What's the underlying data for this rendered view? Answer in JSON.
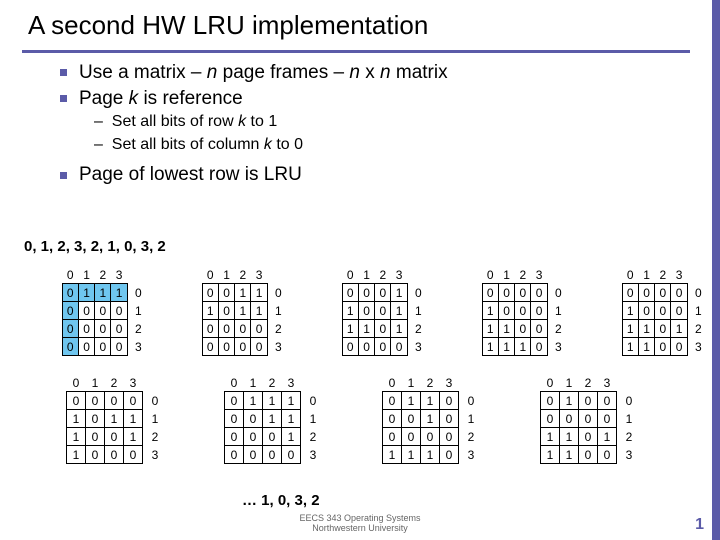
{
  "title": "A second HW LRU implementation",
  "b1a": "Use a matrix –",
  "b1n1": "n",
  "b1b": "page frames –",
  "b1n2": "n",
  "b1x": "x",
  "b1n3": "n",
  "b1c": "matrix",
  "b2a": "Page",
  "b2k": "k",
  "b2b": "is reference",
  "s1a": "Set all bits of row",
  "s1k": "k",
  "s1b": "to 1",
  "s2a": "Set all bits of column",
  "s2k": "k",
  "s2b": "to 0",
  "b3": "Page of lowest row is LRU",
  "seq": "0, 1, 2, 3, 2, 1, 0, 3, 2",
  "ans": "… 1, 0, 3, 2",
  "foot1": "EECS 343 Operating Systems",
  "foot2": "Northwestern University",
  "page": "1",
  "cols": [
    "0",
    "1",
    "2",
    "3"
  ],
  "rows": [
    "0",
    "1",
    "2",
    "3"
  ],
  "mats": [
    {
      "hl": [
        [
          0,
          0
        ],
        [
          0,
          1
        ],
        [
          0,
          2
        ],
        [
          0,
          3
        ],
        [
          1,
          0
        ],
        [
          2,
          0
        ],
        [
          3,
          0
        ]
      ],
      "d": [
        [
          0,
          1,
          1,
          1
        ],
        [
          0,
          0,
          0,
          0
        ],
        [
          0,
          0,
          0,
          0
        ],
        [
          0,
          0,
          0,
          0
        ]
      ]
    },
    {
      "hl": [],
      "d": [
        [
          0,
          0,
          1,
          1
        ],
        [
          1,
          0,
          1,
          1
        ],
        [
          0,
          0,
          0,
          0
        ],
        [
          0,
          0,
          0,
          0
        ]
      ]
    },
    {
      "hl": [],
      "d": [
        [
          0,
          0,
          0,
          1
        ],
        [
          1,
          0,
          0,
          1
        ],
        [
          1,
          1,
          0,
          1
        ],
        [
          0,
          0,
          0,
          0
        ]
      ]
    },
    {
      "hl": [],
      "d": [
        [
          0,
          0,
          0,
          0
        ],
        [
          1,
          0,
          0,
          0
        ],
        [
          1,
          1,
          0,
          0
        ],
        [
          1,
          1,
          1,
          0
        ]
      ]
    },
    {
      "hl": [],
      "d": [
        [
          0,
          0,
          0,
          0
        ],
        [
          1,
          0,
          0,
          0
        ],
        [
          1,
          1,
          0,
          1
        ],
        [
          1,
          1,
          0,
          0
        ]
      ]
    },
    {
      "hl": [],
      "d": [
        [
          0,
          0,
          0,
          0
        ],
        [
          1,
          0,
          1,
          1
        ],
        [
          1,
          0,
          0,
          1
        ],
        [
          1,
          0,
          0,
          0
        ]
      ]
    },
    {
      "hl": [],
      "d": [
        [
          0,
          1,
          1,
          1
        ],
        [
          0,
          0,
          1,
          1
        ],
        [
          0,
          0,
          0,
          1
        ],
        [
          0,
          0,
          0,
          0
        ]
      ]
    },
    {
      "hl": [],
      "d": [
        [
          0,
          1,
          1,
          0
        ],
        [
          0,
          0,
          1,
          0
        ],
        [
          0,
          0,
          0,
          0
        ],
        [
          1,
          1,
          1,
          0
        ]
      ]
    },
    {
      "hl": [],
      "d": [
        [
          0,
          1,
          0,
          0
        ],
        [
          0,
          0,
          0,
          0
        ],
        [
          1,
          1,
          0,
          1
        ],
        [
          1,
          1,
          0,
          0
        ]
      ]
    }
  ]
}
